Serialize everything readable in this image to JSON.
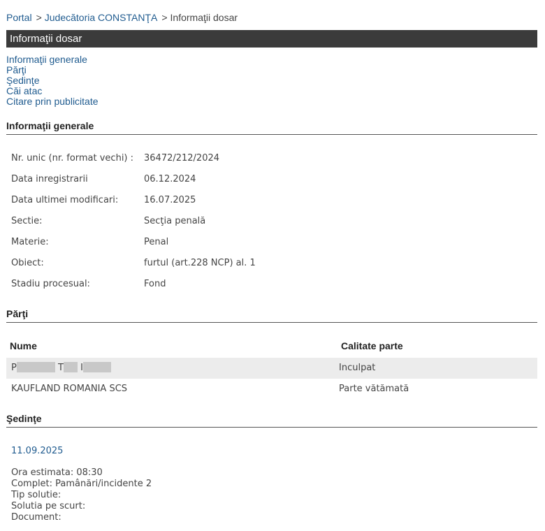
{
  "breadcrumb": {
    "items": [
      "Portal",
      "Judecătoria CONSTANŢA",
      "Informaţii dosar"
    ],
    "separator": ">"
  },
  "title_bar": "Informaţii dosar",
  "nav_links": [
    "Informaţii generale",
    "Părţi",
    "Şedinţe",
    "Căi atac",
    "Citare prin publicitate"
  ],
  "sections": {
    "general": "Informaţii generale",
    "parti": "Părţi",
    "sedinte": "Şedinţe"
  },
  "info": [
    {
      "label": "Nr. unic (nr. format vechi) :",
      "value": "36472/212/2024"
    },
    {
      "label": "Data inregistrarii",
      "value": "06.12.2024"
    },
    {
      "label": "Data ultimei modificari:",
      "value": "16.07.2025"
    },
    {
      "label": "Sectie:",
      "value": "Secţia penală"
    },
    {
      "label": "Materie:",
      "value": "Penal"
    },
    {
      "label": "Obiect:",
      "value": "furtul (art.228 NCP) al. 1"
    },
    {
      "label": "Stadiu procesual:",
      "value": "Fond"
    }
  ],
  "parti": {
    "headers": [
      "Nume",
      "Calitate parte"
    ],
    "rows": [
      {
        "name_initials": [
          "P",
          "T",
          "I"
        ],
        "calitate": "Inculpat"
      },
      {
        "name": "KAUFLAND ROMANIA SCS",
        "calitate": "Parte vătămată"
      }
    ]
  },
  "sedinta": {
    "date": "11.09.2025",
    "details": [
      "Ora estimata: 08:30",
      "Complet: Pamânări/incidente 2",
      "Tip solutie:",
      "Solutia pe scurt:",
      "Document:"
    ]
  }
}
